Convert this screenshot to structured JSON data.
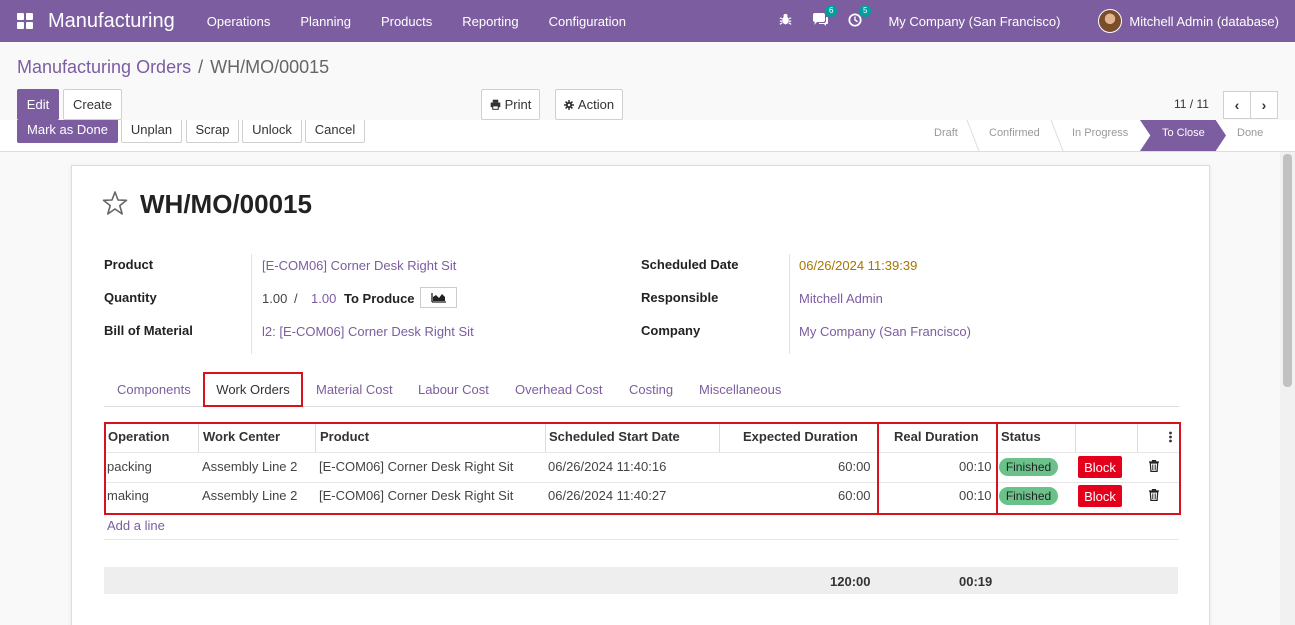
{
  "app": {
    "name": "Manufacturing"
  },
  "menu": [
    "Operations",
    "Planning",
    "Products",
    "Reporting",
    "Configuration"
  ],
  "systray": {
    "messages_count": "6",
    "activities_count": "5",
    "company": "My Company (San Francisco)",
    "user": "Mitchell Admin (database)"
  },
  "breadcrumb": {
    "parent": "Manufacturing Orders",
    "separator": "/",
    "current": "WH/MO/00015"
  },
  "toolbar": {
    "edit": "Edit",
    "create": "Create",
    "print": "Print",
    "action": "Action"
  },
  "pager": {
    "value": "11 / 11"
  },
  "statusbar": {
    "buttons": [
      "Mark as Done",
      "Unplan",
      "Scrap",
      "Unlock",
      "Cancel"
    ],
    "stages": [
      "Draft",
      "Confirmed",
      "In Progress",
      "To Close",
      "Done"
    ],
    "active_stage": "To Close"
  },
  "record": {
    "name": "WH/MO/00015",
    "labels": {
      "product": "Product",
      "quantity": "Quantity",
      "bom": "Bill of Material",
      "scheduled_date": "Scheduled Date",
      "responsible": "Responsible",
      "company": "Company"
    },
    "product": "[E-COM06] Corner Desk Right Sit",
    "qty_produced": "1.00",
    "qty_sep": "/",
    "qty_total": "1.00",
    "qty_suffix": "To Produce",
    "bom": "l2: [E-COM06] Corner Desk Right Sit",
    "scheduled_date": "06/26/2024 11:39:39",
    "responsible": "Mitchell Admin",
    "company": "My Company (San Francisco)"
  },
  "tabs": [
    "Components",
    "Work Orders",
    "Material Cost",
    "Labour Cost",
    "Overhead Cost",
    "Costing",
    "Miscellaneous"
  ],
  "active_tab": "Work Orders",
  "workorders": {
    "headers": [
      "Operation",
      "Work Center",
      "Product",
      "Scheduled Start Date",
      "Expected Duration",
      "Real Duration",
      "Status"
    ],
    "rows": [
      {
        "operation": "packing",
        "work_center": "Assembly Line 2",
        "product": "[E-COM06] Corner Desk Right Sit",
        "start": "06/26/2024 11:40:16",
        "expected": "60:00",
        "real": "00:10",
        "status": "Finished",
        "action": "Block"
      },
      {
        "operation": "making",
        "work_center": "Assembly Line 2",
        "product": "[E-COM06] Corner Desk Right Sit",
        "start": "06/26/2024 11:40:27",
        "expected": "60:00",
        "real": "00:10",
        "status": "Finished",
        "action": "Block"
      }
    ],
    "add_line": "Add a line",
    "total_expected": "120:00",
    "total_real": "00:19"
  },
  "colors": {
    "brand": "#7c5da0",
    "highlight": "#d6121f",
    "finished": "#6ac28a",
    "block": "#e4001b"
  }
}
